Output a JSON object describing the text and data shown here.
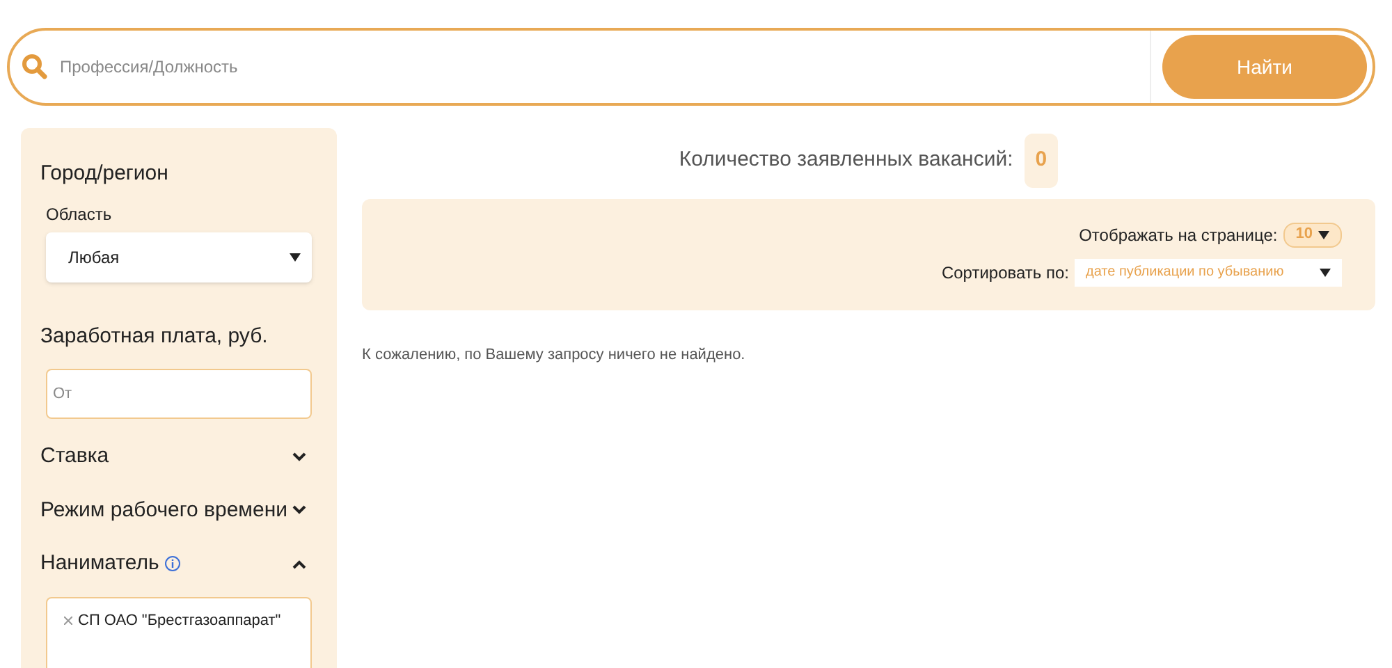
{
  "search": {
    "placeholder": "Профессия/Должность",
    "button": "Найти"
  },
  "filters": [
    {
      "kind": "select",
      "title": "Город/регион",
      "label": "Область",
      "value": "Любая"
    },
    {
      "kind": "input",
      "title": "Заработная плата, руб.",
      "placeholder": "От"
    },
    {
      "kind": "section",
      "title": "Ставка",
      "expanded": false
    },
    {
      "kind": "section",
      "title": "Режим рабочего времени",
      "expanded": false
    },
    {
      "kind": "section",
      "title": "Наниматель",
      "info": true,
      "expanded": true,
      "tags": [
        "СП ОАО \"Брестгазоаппарат\""
      ]
    }
  ],
  "results": {
    "count_label": "Количество заявленных вакансий:",
    "count": "0",
    "per_page_label": "Отображать на странице:",
    "per_page": "10",
    "sort_label": "Сортировать по:",
    "sort": "дате публикации по убыванию",
    "message": "К сожалению, по Вашему запросу ничего не найдено."
  }
}
